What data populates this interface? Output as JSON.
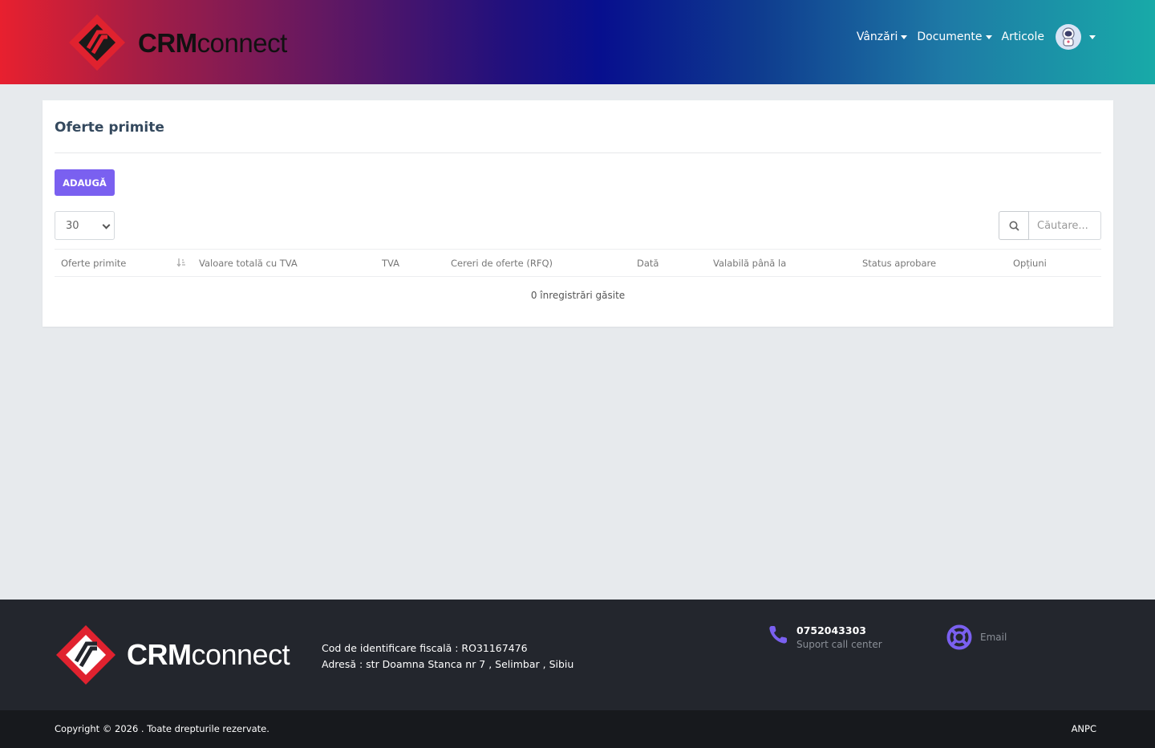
{
  "header": {
    "brand_bold": "CRM",
    "brand_light": "connect",
    "nav": [
      {
        "label": "Vânzări",
        "has_dropdown": true
      },
      {
        "label": "Documente",
        "has_dropdown": true
      },
      {
        "label": "Articole",
        "has_dropdown": false
      }
    ]
  },
  "page": {
    "title": "Oferte primite",
    "add_button": "ADAUGĂ",
    "per_page": "30",
    "search_placeholder": "Căutare...",
    "columns": [
      "Oferte primite",
      "Valoare totală cu TVA",
      "TVA",
      "Cereri de oferte (RFQ)",
      "Dată",
      "Valabilă până la",
      "Status aprobare",
      "Opțiuni"
    ],
    "empty_message": "0 înregistrări găsite"
  },
  "footer": {
    "brand_bold": "CRM",
    "brand_light": "connect",
    "fiscal_code": "Cod de identificare fiscală : RO31167476",
    "address": "Adresă : str Doamna Stanca nr 7 , Selimbar , Sibiu",
    "phone": "0752043303",
    "phone_sub": "Suport call center",
    "email_label": "Email",
    "copyright": "Copyright © 2026 . Toate drepturile rezervate.",
    "anpc": "ANPC"
  },
  "colors": {
    "accent": "#7a60f0",
    "footer_bg": "#23262d",
    "bottom_bar_bg": "#17191d",
    "page_bg": "#e7eaed"
  }
}
